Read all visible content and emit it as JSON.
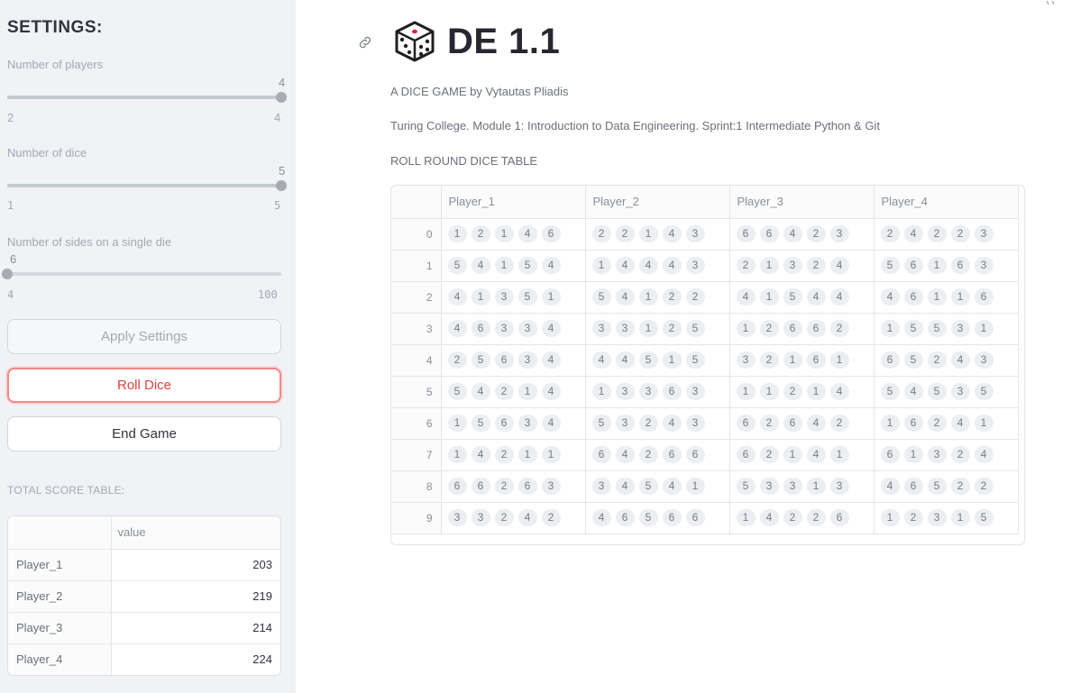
{
  "sidebar": {
    "title": "SETTINGS:",
    "sliders": [
      {
        "label": "Number of players",
        "value": "4",
        "min": "2",
        "max": "4",
        "fraction": 1.0
      },
      {
        "label": "Number of dice",
        "value": "5",
        "min": "1",
        "max": "5",
        "fraction": 1.0
      },
      {
        "label": "Number of sides on a single die",
        "value": "6",
        "min": "4",
        "max": "100",
        "fraction": 0.0
      }
    ],
    "buttons": {
      "apply": "Apply Settings",
      "roll": "Roll Dice",
      "end": "End Game"
    },
    "score_table": {
      "title": "TOTAL SCORE TABLE:",
      "column": "value",
      "rows": [
        {
          "player": "Player_1",
          "value": "203"
        },
        {
          "player": "Player_2",
          "value": "219"
        },
        {
          "player": "Player_3",
          "value": "214"
        },
        {
          "player": "Player_4",
          "value": "224"
        }
      ]
    }
  },
  "main": {
    "title": "DE 1.1",
    "subtitle": "A DICE GAME by Vytautas Pliadis",
    "course": "Turing College. Module 1: Introduction to Data Engineering. Sprint:1 Intermediate Python & Git",
    "table_label": "ROLL ROUND DICE TABLE",
    "dice_table": {
      "columns": [
        "Player_1",
        "Player_2",
        "Player_3",
        "Player_4"
      ],
      "rows": [
        {
          "index": "0",
          "cells": [
            [
              1,
              2,
              1,
              4,
              6
            ],
            [
              2,
              2,
              1,
              4,
              3
            ],
            [
              6,
              6,
              4,
              2,
              3
            ],
            [
              2,
              4,
              2,
              2,
              3
            ]
          ]
        },
        {
          "index": "1",
          "cells": [
            [
              5,
              4,
              1,
              5,
              4
            ],
            [
              1,
              4,
              4,
              4,
              3
            ],
            [
              2,
              1,
              3,
              2,
              4
            ],
            [
              5,
              6,
              1,
              6,
              3
            ]
          ]
        },
        {
          "index": "2",
          "cells": [
            [
              4,
              1,
              3,
              5,
              1
            ],
            [
              5,
              4,
              1,
              2,
              2
            ],
            [
              4,
              1,
              5,
              4,
              4
            ],
            [
              4,
              6,
              1,
              1,
              6
            ]
          ]
        },
        {
          "index": "3",
          "cells": [
            [
              4,
              6,
              3,
              3,
              4
            ],
            [
              3,
              3,
              1,
              2,
              5
            ],
            [
              1,
              2,
              6,
              6,
              2
            ],
            [
              1,
              5,
              5,
              3,
              1
            ]
          ]
        },
        {
          "index": "4",
          "cells": [
            [
              2,
              5,
              6,
              3,
              4
            ],
            [
              4,
              4,
              5,
              1,
              5
            ],
            [
              3,
              2,
              1,
              6,
              1
            ],
            [
              6,
              5,
              2,
              4,
              3
            ]
          ]
        },
        {
          "index": "5",
          "cells": [
            [
              5,
              4,
              2,
              1,
              4
            ],
            [
              1,
              3,
              3,
              6,
              3
            ],
            [
              1,
              1,
              2,
              1,
              4
            ],
            [
              5,
              4,
              5,
              3,
              5
            ]
          ]
        },
        {
          "index": "6",
          "cells": [
            [
              1,
              5,
              6,
              3,
              4
            ],
            [
              5,
              3,
              2,
              4,
              3
            ],
            [
              6,
              2,
              6,
              4,
              2
            ],
            [
              1,
              6,
              2,
              4,
              1
            ]
          ]
        },
        {
          "index": "7",
          "cells": [
            [
              1,
              4,
              2,
              1,
              1
            ],
            [
              6,
              4,
              2,
              6,
              6
            ],
            [
              6,
              2,
              1,
              4,
              1
            ],
            [
              6,
              1,
              3,
              2,
              4
            ]
          ]
        },
        {
          "index": "8",
          "cells": [
            [
              6,
              6,
              2,
              6,
              3
            ],
            [
              3,
              4,
              5,
              4,
              1
            ],
            [
              5,
              3,
              3,
              1,
              3
            ],
            [
              4,
              6,
              5,
              2,
              2
            ]
          ]
        },
        {
          "index": "9",
          "cells": [
            [
              3,
              3,
              2,
              4,
              2
            ],
            [
              4,
              6,
              5,
              6,
              6
            ],
            [
              1,
              4,
              2,
              2,
              6
            ],
            [
              1,
              2,
              3,
              1,
              5
            ]
          ]
        }
      ]
    }
  },
  "colors": {
    "sidebar_bg": "#f0f2f6",
    "accent_red": "#e0403f",
    "chip_bg": "#eceef1"
  },
  "icons": [
    "link-icon",
    "dice-icon"
  ]
}
